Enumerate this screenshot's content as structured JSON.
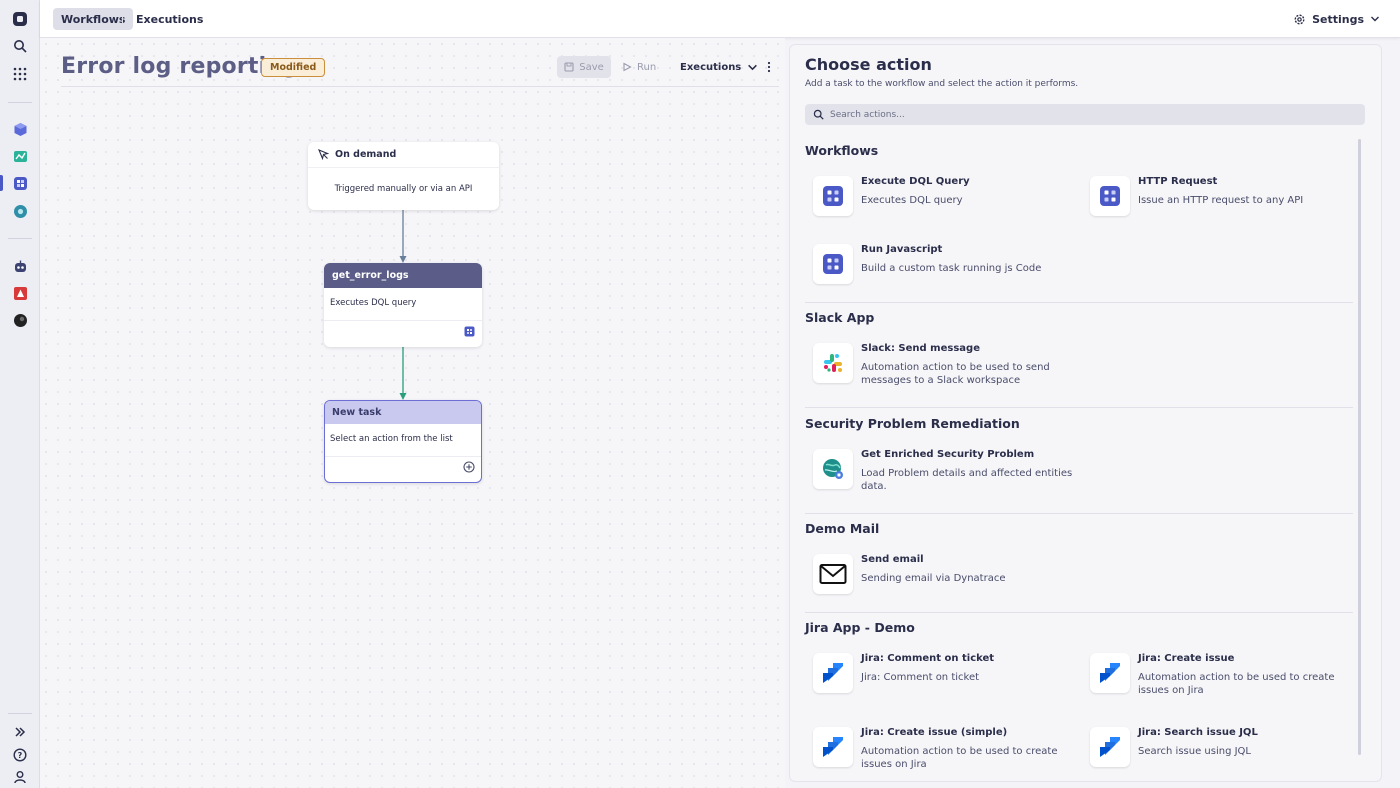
{
  "topbar": {
    "tabs": [
      "Workflows",
      "Executions"
    ],
    "settings_label": "Settings"
  },
  "workflow": {
    "title": "Error log reporting",
    "status_badge": "Modified",
    "toolbar": {
      "save_label": "Save",
      "run_label": "Run",
      "executions_label": "Executions"
    },
    "nodes": {
      "trigger": {
        "title": "On demand",
        "description": "Triggered manually or via an API"
      },
      "task": {
        "title": "get_error_logs",
        "description": "Executes DQL query"
      },
      "new_task": {
        "title": "New task",
        "description": "Select an action from the list"
      }
    }
  },
  "panel": {
    "title": "Choose action",
    "subtitle": "Add a task to the workflow and select the action it performs.",
    "search_placeholder": "Search actions...",
    "sections": [
      {
        "title": "Workflows",
        "actions": [
          {
            "name": "Execute DQL Query",
            "description": "Executes DQL query",
            "icon": "workflow-icon"
          },
          {
            "name": "HTTP Request",
            "description": "Issue an HTTP request to any API",
            "icon": "workflow-icon"
          },
          {
            "name": "Run Javascript",
            "description": "Build a custom task running js Code",
            "icon": "workflow-icon"
          }
        ]
      },
      {
        "title": "Slack App",
        "actions": [
          {
            "name": "Slack: Send message",
            "description": "Automation action to be used to send messages to a Slack workspace",
            "icon": "slack-icon"
          }
        ]
      },
      {
        "title": "Security Problem Remediation",
        "actions": [
          {
            "name": "Get Enriched Security Problem",
            "description": "Load Problem details and affected entities data.",
            "icon": "security-globe-icon"
          }
        ]
      },
      {
        "title": "Demo Mail",
        "actions": [
          {
            "name": "Send email",
            "description": "Sending email via Dynatrace",
            "icon": "mail-icon"
          }
        ]
      },
      {
        "title": "Jira App - Demo",
        "actions": [
          {
            "name": "Jira: Comment on ticket",
            "description": "Jira: Comment on ticket",
            "icon": "jira-icon"
          },
          {
            "name": "Jira: Create issue",
            "description": "Automation action to be used to create issues on Jira",
            "icon": "jira-icon"
          },
          {
            "name": "Jira: Create issue (simple)",
            "description": "Automation action to be used to create issues on Jira",
            "icon": "jira-icon"
          },
          {
            "name": "Jira: Search issue JQL",
            "description": "Search issue using JQL",
            "icon": "jira-icon"
          }
        ]
      }
    ]
  },
  "colors": {
    "accent": "#4b59c7",
    "task_header": "#5b5c87",
    "new_task_border": "#6d6fd4",
    "badge_border": "#c98f3c"
  }
}
